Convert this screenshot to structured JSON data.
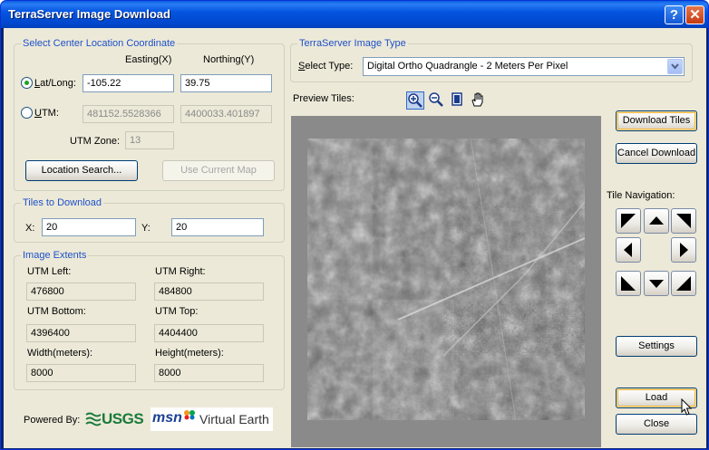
{
  "window": {
    "title": "TerraServer Image Download",
    "help_label": "?",
    "close_label": "✕"
  },
  "center": {
    "group_label": "Select Center Location Coordinate",
    "easting_header": "Easting(X)",
    "northing_header": "Northing(Y)",
    "latlong_label": "Lat/Long:",
    "latlong_selected": true,
    "lon_value": "-105.22",
    "lat_value": "39.75",
    "utm_label": "UTM:",
    "utm_easting": "481152.5528366",
    "utm_northing": "4400033.401897",
    "utm_zone_label": "UTM Zone:",
    "utm_zone_value": "13",
    "location_search_label": "Location Search...",
    "use_current_map_label": "Use Current Map"
  },
  "tiles": {
    "group_label": "Tiles to Download",
    "x_label": "X:",
    "x_value": "20",
    "y_label": "Y:",
    "y_value": "20"
  },
  "extents": {
    "group_label": "Image Extents",
    "utm_left_label": "UTM Left:",
    "utm_left_value": "476800",
    "utm_right_label": "UTM Right:",
    "utm_right_value": "484800",
    "utm_bottom_label": "UTM Bottom:",
    "utm_bottom_value": "4396400",
    "utm_top_label": "UTM Top:",
    "utm_top_value": "4404400",
    "width_label": "Width(meters):",
    "width_value": "8000",
    "height_label": "Height(meters):",
    "height_value": "8000"
  },
  "footer": {
    "powered_by": "Powered By:",
    "usgs_logo": "USGS",
    "msn_logo": "msn",
    "virtual_earth": "Virtual Earth"
  },
  "image_type": {
    "group_label": "TerraServer Image Type",
    "select_type_label": "Select Type:",
    "selected_value": "Digital Ortho Quadrangle - 2 Meters Per Pixel"
  },
  "preview": {
    "label": "Preview Tiles:",
    "tools": [
      "zoom-in-icon",
      "zoom-out-icon",
      "page-icon",
      "hand-pan-icon"
    ]
  },
  "actions": {
    "download_tiles": "Download Tiles",
    "cancel_download": "Cancel Download",
    "tile_navigation_label": "Tile Navigation:",
    "settings": "Settings",
    "load": "Load",
    "close": "Close"
  },
  "colors": {
    "group_label": "#1e50c8",
    "title_bar": "#0555e0",
    "dialog_bg": "#ece9d8",
    "usgs_green": "#1a7a3a"
  }
}
